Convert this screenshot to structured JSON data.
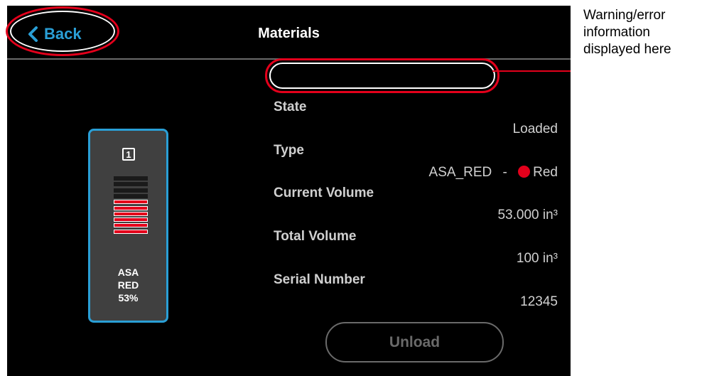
{
  "header": {
    "title": "Materials",
    "back_label": "Back"
  },
  "annotation": {
    "lines": [
      "Warning/error",
      "information",
      "displayed here"
    ]
  },
  "warning": {
    "text": ""
  },
  "canister": {
    "slot": "1",
    "fill_percent": 53,
    "total_bars": 10,
    "filled_bars": 6,
    "label_lines": [
      "ASA",
      "RED",
      "53%"
    ]
  },
  "details": {
    "state": {
      "label": "State",
      "value": "Loaded"
    },
    "type": {
      "label": "Type",
      "value": "ASA_RED",
      "separator": "-",
      "color_name": "Red"
    },
    "current_volume": {
      "label": "Current Volume",
      "value": "53.000 in³"
    },
    "total_volume": {
      "label": "Total Volume",
      "value": "100 in³"
    },
    "serial_number": {
      "label": "Serial Number",
      "value": "12345"
    }
  },
  "actions": {
    "unload_label": "Unload"
  },
  "colors": {
    "accent": "#2a9fd6",
    "highlight": "#e3001b",
    "material": "#e3001b"
  }
}
